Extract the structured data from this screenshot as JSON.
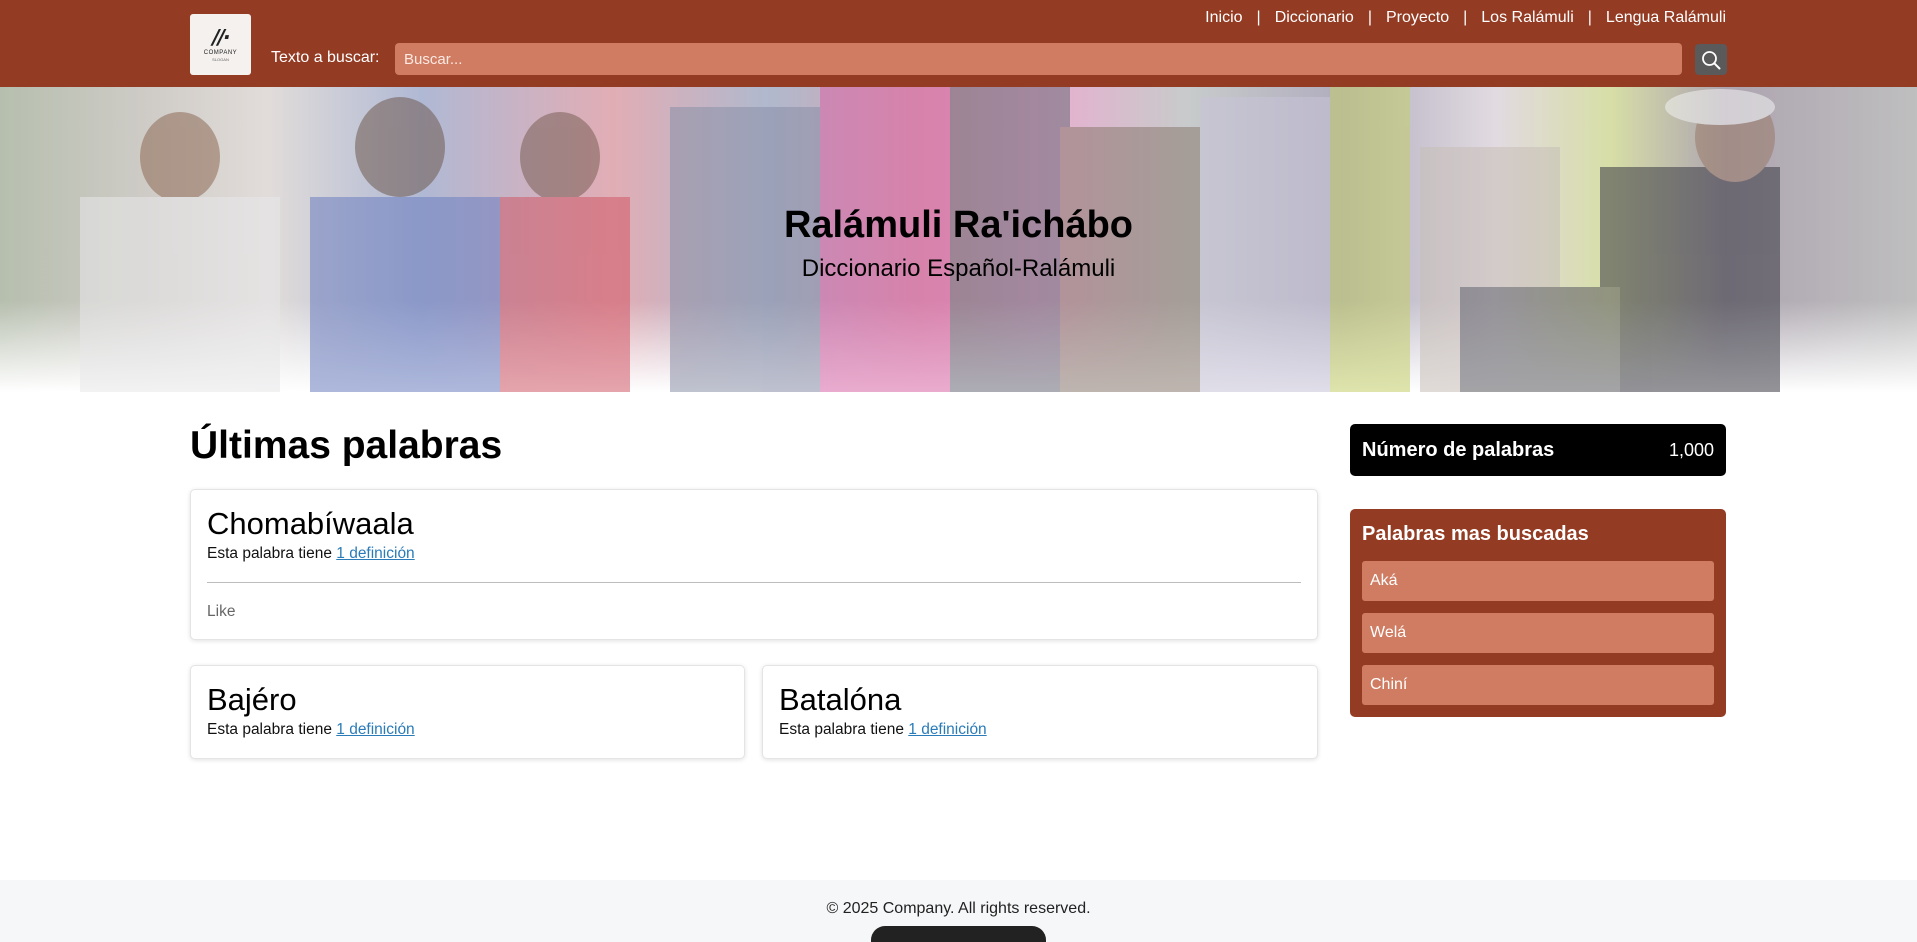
{
  "header": {
    "logo_text": "COMPANY",
    "logo_sub": "SLOGAN",
    "nav": [
      "Inicio",
      "Diccionario",
      "Proyecto",
      "Los Ralámuli",
      "Lengua Ralámuli"
    ],
    "nav_separator": "|",
    "search_label": "Texto a buscar:",
    "search_placeholder": "Buscar...",
    "search_icon": "search-icon"
  },
  "hero": {
    "title": "Ralámuli Ra'ichábo",
    "subtitle": "Diccionario Español-Ralámuli"
  },
  "main": {
    "section_title": "Últimas palabras",
    "cards": [
      {
        "word": "Chomabíwaala",
        "def_prefix": "Esta palabra tiene",
        "def_link": "1 definición",
        "like": "Like"
      },
      {
        "word": "Bajéro",
        "def_prefix": "Esta palabra tiene",
        "def_link": "1 definición"
      },
      {
        "word": "Batalóna",
        "def_prefix": "Esta palabra tiene",
        "def_link": "1 definición"
      }
    ]
  },
  "sidebar": {
    "stat_label": "Número de palabras",
    "stat_value": "1,000",
    "popular_title": "Palabras mas buscadas",
    "popular": [
      "Aká",
      "Welá",
      "Chiní"
    ]
  },
  "footer": {
    "text": "© 2025 Company. All rights reserved."
  },
  "colors": {
    "brand": "#943b23",
    "accent": "#cf7c62",
    "link": "#2a7bb8"
  }
}
